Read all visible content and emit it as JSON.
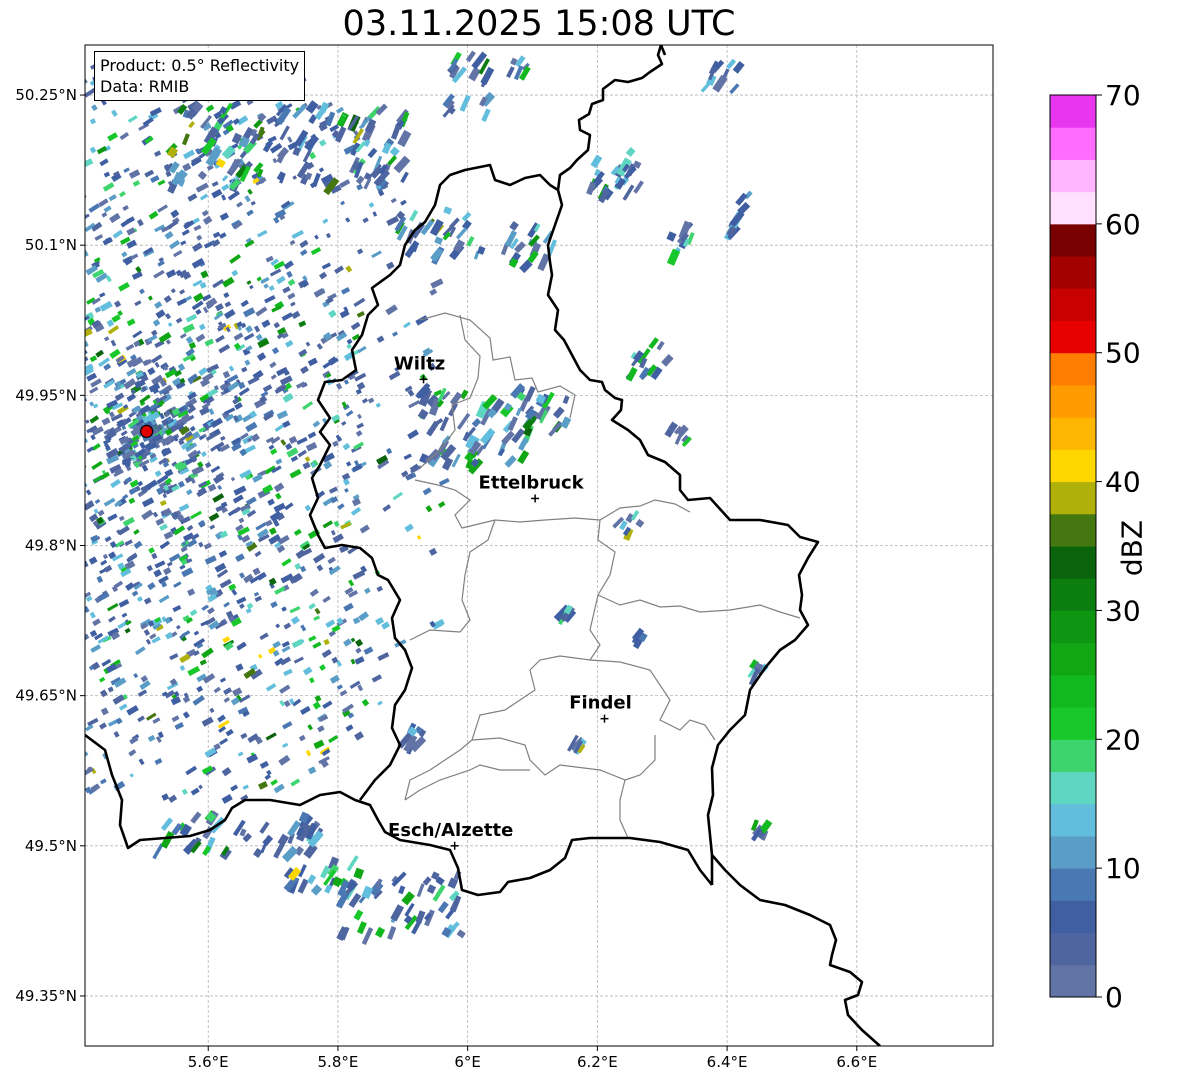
{
  "title": "03.11.2025 15:08 UTC",
  "info": {
    "product": "Product: 0.5° Reflectivity",
    "source": "Data: RMIB"
  },
  "map": {
    "lon_range": [
      5.41,
      6.81
    ],
    "lat_range": [
      49.3,
      50.3
    ],
    "lon_ticks": [
      {
        "value": 5.6,
        "label": "5.6°E"
      },
      {
        "value": 5.8,
        "label": "5.8°E"
      },
      {
        "value": 6.0,
        "label": "6°E"
      },
      {
        "value": 6.2,
        "label": "6.2°E"
      },
      {
        "value": 6.4,
        "label": "6.4°E"
      },
      {
        "value": 6.6,
        "label": "6.6°E"
      }
    ],
    "lat_ticks": [
      {
        "value": 50.25,
        "label": "50.25°N"
      },
      {
        "value": 50.1,
        "label": "50.1°N"
      },
      {
        "value": 49.95,
        "label": "49.95°N"
      },
      {
        "value": 49.8,
        "label": "49.8°N"
      },
      {
        "value": 49.65,
        "label": "49.65°N"
      },
      {
        "value": 49.5,
        "label": "49.5°N"
      },
      {
        "value": 49.35,
        "label": "49.35°N"
      }
    ],
    "grid": true,
    "radar_site": {
      "lon": 5.505,
      "lat": 49.914,
      "color": "#e00000"
    },
    "cities": [
      {
        "name": "Wiltz",
        "lon": 5.932,
        "lat": 49.966
      },
      {
        "name": "Ettelbruck",
        "lon": 6.104,
        "lat": 49.847
      },
      {
        "name": "Findel",
        "lon": 6.211,
        "lat": 49.627
      },
      {
        "name": "Esch/Alzette",
        "lon": 5.98,
        "lat": 49.5
      }
    ]
  },
  "colorbar": {
    "label": "dBZ",
    "min": 0,
    "max": 70,
    "ticks": [
      "0",
      "10",
      "20",
      "30",
      "40",
      "50",
      "60",
      "70"
    ],
    "colors": [
      "#6273a6",
      "#4f659f",
      "#3f5fa2",
      "#4a78b2",
      "#5a9ec8",
      "#62bedc",
      "#5fd6c1",
      "#3ed46d",
      "#18c72a",
      "#12b81f",
      "#10a614",
      "#0e9512",
      "#0c7e10",
      "#0a640b",
      "#44770f",
      "#b0b00a",
      "#ffd700",
      "#ffb600",
      "#ff9a00",
      "#ff7e00",
      "#e80000",
      "#c80000",
      "#a50000",
      "#780000",
      "#ffe1ff",
      "#ffb5ff",
      "#ff6cff",
      "#e835ef"
    ]
  }
}
